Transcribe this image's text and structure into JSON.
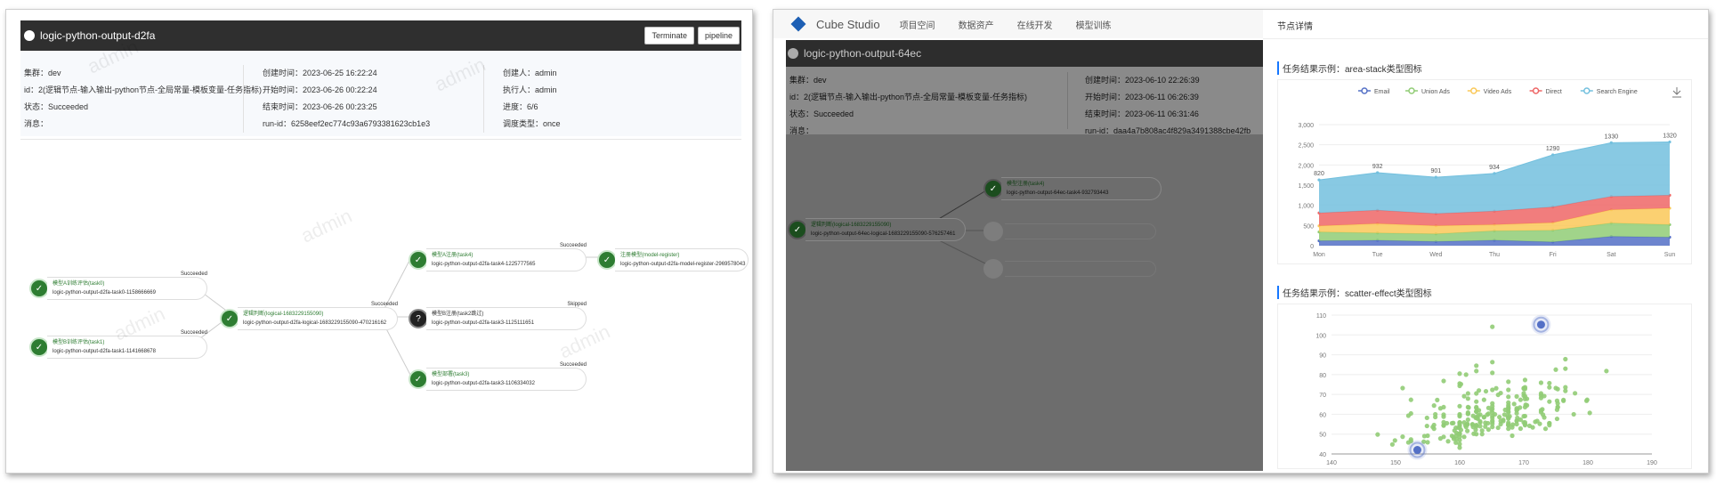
{
  "left": {
    "title": "logic-python-output-d2fa",
    "buttons": [
      "Terminate",
      "pipeline"
    ],
    "info_col1": [
      "集群：dev",
      "id：2(逻辑节点-输入输出-python节点-全局常量-模板变量-任务指标)",
      "状态：Succeeded",
      "消息："
    ],
    "info_col2": [
      "创建时间：2023-06-25 16:22:24",
      "开始时间：2023-06-26 00:22:24",
      "结束时间：2023-06-26 00:23:25",
      "run-id：6258eef2ec774c93a6793381623cb1e3"
    ],
    "info_col3": [
      "创建人：admin",
      "执行人：admin",
      "进度：6/6",
      "调度类型：once"
    ],
    "nodes": [
      {
        "name": "模型A训练评估(task0)",
        "id": "logic-python-output-d2fa-task0-1158666669",
        "status": "Succeeded",
        "dark": false
      },
      {
        "name": "模型B训练评估(task1)",
        "id": "logic-python-output-d2fa-task1-1141668678",
        "status": "Succeeded",
        "dark": false
      },
      {
        "name": "逻辑判断(logical-1683229155090)",
        "id": "logic-python-output-d2fa-logical-1683229155090-470216162",
        "status": "Succeeded",
        "dark": false
      },
      {
        "name": "模型A注册(task4)",
        "id": "logic-python-output-d2fa-task4-1225777565",
        "status": "Succeeded",
        "dark": false
      },
      {
        "name": "模型B注册(task2跳过)",
        "id": "logic-python-output-d2fa-task3-1125111651",
        "status": "Skipped",
        "dark": true
      },
      {
        "name": "模型部署(task3)",
        "id": "logic-python-output-d2fa-task3-1106334032",
        "status": "Succeeded",
        "dark": false
      },
      {
        "name": "注册模型(model-register)",
        "id": "logic-python-output-d2fa-model-register-2969578043",
        "status": "",
        "dark": false
      }
    ],
    "watermark": "admin"
  },
  "right": {
    "brand": "Cube Studio",
    "nav": [
      "项目空间",
      "数据资产",
      "在线开发",
      "模型训练"
    ],
    "title": "logic-python-output-64ec",
    "info_col1": [
      "集群：dev",
      "id：2(逻辑节点-输入输出-python节点-全局常量-模板变量-任务指标)",
      "状态：Succeeded",
      "消息："
    ],
    "info_col2": [
      "创建时间：2023-06-10 22:26:39",
      "开始时间：2023-06-11 06:26:39",
      "结束时间：2023-06-11 06:31:46",
      "run-id：daa4a7b808ac4f829a3491388cbe42fb"
    ],
    "nodes": [
      {
        "name": "模型注册(task4)",
        "id": "logic-python-output-64ec-task4-932793443"
      },
      {
        "name": "逻辑判断(logical-1683229155090)",
        "id": "logic-python-output-64ec-logical-1683229155090-576257461"
      }
    ],
    "drawer_title": "节点详情",
    "section1": "任务结果示例：area-stack类型图标",
    "section2": "任务结果示例：scatter-effect类型图标"
  },
  "chart_data": [
    {
      "type": "area",
      "stacked": true,
      "title": "",
      "categories": [
        "Mon",
        "Tue",
        "Wed",
        "Thu",
        "Fri",
        "Sat",
        "Sun"
      ],
      "series": [
        {
          "name": "Email",
          "values": [
            120,
            132,
            101,
            134,
            90,
            230,
            210
          ],
          "color": "#5470c6"
        },
        {
          "name": "Union Ads",
          "values": [
            220,
            182,
            191,
            234,
            290,
            330,
            310
          ],
          "color": "#91cc75"
        },
        {
          "name": "Video Ads",
          "values": [
            150,
            232,
            201,
            154,
            190,
            330,
            410
          ],
          "color": "#fac858"
        },
        {
          "name": "Direct",
          "values": [
            320,
            332,
            301,
            334,
            390,
            330,
            320
          ],
          "color": "#ee6666"
        },
        {
          "name": "Search Engine",
          "values": [
            820,
            932,
            901,
            934,
            1290,
            1330,
            1320
          ],
          "color": "#73c0de"
        }
      ],
      "top_labels": [
        "820",
        "932",
        "901",
        "934",
        "1290",
        "1330",
        "1320"
      ],
      "yticks": [
        "0",
        "500",
        "1,000",
        "1,500",
        "2,000",
        "2,500",
        "3,000"
      ],
      "ylim": [
        0,
        3000
      ],
      "legend": "top-center",
      "grid": true
    },
    {
      "type": "scatter",
      "title": "",
      "xticks": [
        "140",
        "150",
        "160",
        "170",
        "180",
        "190"
      ],
      "yticks": [
        "40",
        "50",
        "60",
        "70",
        "80",
        "90",
        "100",
        "110"
      ],
      "xlim": [
        140,
        190
      ],
      "ylim": [
        40,
        110
      ],
      "effect_points": [
        [
          153.4,
          42.0
        ],
        [
          172.7,
          105.2
        ]
      ],
      "points": [
        [
          161.2,
          51.6
        ],
        [
          167.5,
          59.0
        ],
        [
          159.5,
          49.2
        ],
        [
          157.0,
          63.0
        ],
        [
          155.8,
          53.6
        ],
        [
          170.0,
          59.0
        ],
        [
          159.1,
          47.6
        ],
        [
          166.0,
          69.8
        ],
        [
          176.2,
          66.8
        ],
        [
          160.2,
          75.2
        ],
        [
          172.5,
          55.2
        ],
        [
          170.9,
          54.2
        ],
        [
          172.9,
          62.5
        ],
        [
          153.4,
          42.0
        ],
        [
          160.0,
          50.0
        ],
        [
          147.2,
          49.8
        ],
        [
          168.2,
          49.2
        ],
        [
          175.0,
          73.2
        ],
        [
          157.0,
          47.8
        ],
        [
          167.6,
          68.8
        ],
        [
          159.5,
          50.6
        ],
        [
          175.0,
          82.5
        ],
        [
          166.8,
          57.2
        ],
        [
          176.5,
          87.8
        ],
        [
          170.2,
          72.8
        ],
        [
          174.0,
          54.5
        ],
        [
          173.0,
          59.8
        ],
        [
          179.9,
          67.3
        ],
        [
          170.5,
          67.8
        ],
        [
          160.0,
          47.0
        ],
        [
          154.4,
          46.2
        ],
        [
          162.0,
          55.0
        ],
        [
          176.5,
          83.0
        ],
        [
          160.0,
          54.4
        ],
        [
          152.0,
          45.8
        ],
        [
          162.1,
          53.6
        ],
        [
          170.0,
          73.2
        ],
        [
          160.2,
          52.1
        ],
        [
          161.3,
          67.9
        ],
        [
          166.4,
          56.6
        ],
        [
          168.9,
          62.3
        ],
        [
          163.8,
          58.5
        ],
        [
          167.6,
          54.5
        ],
        [
          160.0,
          50.2
        ],
        [
          161.3,
          60.3
        ],
        [
          167.6,
          58.3
        ],
        [
          165.1,
          56.2
        ],
        [
          160.0,
          50.2
        ],
        [
          170.0,
          72.9
        ],
        [
          157.5,
          59.8
        ],
        [
          167.6,
          61.0
        ],
        [
          160.7,
          69.1
        ],
        [
          163.2,
          55.9
        ],
        [
          152.4,
          46.5
        ],
        [
          157.5,
          54.3
        ],
        [
          168.3,
          54.8
        ],
        [
          180.3,
          60.7
        ],
        [
          165.5,
          60.0
        ],
        [
          165.0,
          62.0
        ],
        [
          164.5,
          60.3
        ],
        [
          156.0,
          52.7
        ],
        [
          160.0,
          74.3
        ],
        [
          163.0,
          62.0
        ],
        [
          165.7,
          73.1
        ],
        [
          161.0,
          80.0
        ],
        [
          162.0,
          54.7
        ],
        [
          166.0,
          53.2
        ],
        [
          174.0,
          75.7
        ],
        [
          172.7,
          61.1
        ],
        [
          167.6,
          55.7
        ],
        [
          151.1,
          48.7
        ],
        [
          164.5,
          52.3
        ],
        [
          163.5,
          50.0
        ],
        [
          152.0,
          59.3
        ],
        [
          169.0,
          62.5
        ],
        [
          164.0,
          55.7
        ],
        [
          161.2,
          54.8
        ],
        [
          155.0,
          45.9
        ],
        [
          170.0,
          70.6
        ],
        [
          176.2,
          67.2
        ],
        [
          170.0,
          69.4
        ],
        [
          162.5,
          58.2
        ],
        [
          170.3,
          64.8
        ],
        [
          164.1,
          71.6
        ],
        [
          169.5,
          52.8
        ],
        [
          163.2,
          59.8
        ],
        [
          154.5,
          49.0
        ],
        [
          159.8,
          50.0
        ],
        [
          173.2,
          69.2
        ],
        [
          170.0,
          55.9
        ],
        [
          161.4,
          63.4
        ],
        [
          169.0,
          58.2
        ],
        [
          166.2,
          58.6
        ],
        [
          159.4,
          45.7
        ],
        [
          162.5,
          52.2
        ],
        [
          159.0,
          48.6
        ],
        [
          162.8,
          57.8
        ],
        [
          159.0,
          55.6
        ],
        [
          179.8,
          66.8
        ],
        [
          162.9,
          59.4
        ],
        [
          161.0,
          53.6
        ],
        [
          151.1,
          73.2
        ],
        [
          168.2,
          53.4
        ],
        [
          168.9,
          69.0
        ],
        [
          173.2,
          58.4
        ],
        [
          171.8,
          56.2
        ],
        [
          178.0,
          70.6
        ],
        [
          164.3,
          59.8
        ],
        [
          163.0,
          72.0
        ],
        [
          168.5,
          65.2
        ],
        [
          166.8,
          56.6
        ],
        [
          172.7,
          105.2
        ],
        [
          163.5,
          51.8
        ],
        [
          169.4,
          63.4
        ],
        [
          167.8,
          59.0
        ],
        [
          159.5,
          47.6
        ],
        [
          167.6,
          63.0
        ],
        [
          161.2,
          55.2
        ],
        [
          160.0,
          45.0
        ],
        [
          163.2,
          54.0
        ],
        [
          162.2,
          50.2
        ],
        [
          161.3,
          60.2
        ],
        [
          149.5,
          44.8
        ],
        [
          157.5,
          58.8
        ],
        [
          163.2,
          56.4
        ],
        [
          172.7,
          62.0
        ],
        [
          155.0,
          49.2
        ],
        [
          156.5,
          67.2
        ],
        [
          164.0,
          53.8
        ],
        [
          160.9,
          54.4
        ],
        [
          162.8,
          58.0
        ],
        [
          167.0,
          59.8
        ],
        [
          160.0,
          54.8
        ],
        [
          160.0,
          43.2
        ],
        [
          168.9,
          60.5
        ],
        [
          158.2,
          46.4
        ],
        [
          156.0,
          64.4
        ],
        [
          160.0,
          48.8
        ],
        [
          167.1,
          62.2
        ],
        [
          158.0,
          55.5
        ],
        [
          167.6,
          57.8
        ],
        [
          156.0,
          54.6
        ],
        [
          162.1,
          59.2
        ],
        [
          173.4,
          52.7
        ],
        [
          159.8,
          53.2
        ],
        [
          170.5,
          64.5
        ],
        [
          159.2,
          51.8
        ],
        [
          157.5,
          56.0
        ],
        [
          161.3,
          63.6
        ],
        [
          162.6,
          63.2
        ],
        [
          160.0,
          59.5
        ],
        [
          168.9,
          56.8
        ],
        [
          165.1,
          64.1
        ],
        [
          162.6,
          50.0
        ],
        [
          165.1,
          72.3
        ],
        [
          166.4,
          55.0
        ],
        [
          160.0,
          55.9
        ],
        [
          152.4,
          60.4
        ],
        [
          170.2,
          69.1
        ],
        [
          162.6,
          84.5
        ],
        [
          170.2,
          55.9
        ],
        [
          158.8,
          55.5
        ],
        [
          172.7,
          69.5
        ],
        [
          167.6,
          76.4
        ],
        [
          162.6,
          61.4
        ],
        [
          167.6,
          65.9
        ],
        [
          156.2,
          58.6
        ],
        [
          175.2,
          66.8
        ],
        [
          172.1,
          56.6
        ],
        [
          162.6,
          58.6
        ],
        [
          160.0,
          55.9
        ],
        [
          165.1,
          59.1
        ],
        [
          182.9,
          81.8
        ],
        [
          166.4,
          70.7
        ],
        [
          165.1,
          56.8
        ],
        [
          177.8,
          60.0
        ],
        [
          165.1,
          58.2
        ],
        [
          175.3,
          72.7
        ],
        [
          154.9,
          54.1
        ],
        [
          158.8,
          49.1
        ],
        [
          172.7,
          75.9
        ],
        [
          168.9,
          55.0
        ],
        [
          161.3,
          57.3
        ],
        [
          167.6,
          55.0
        ],
        [
          165.1,
          65.5
        ],
        [
          175.3,
          65.5
        ],
        [
          157.5,
          48.6
        ],
        [
          163.8,
          58.6
        ],
        [
          167.6,
          63.6
        ],
        [
          165.1,
          55.2
        ],
        [
          165.1,
          62.7
        ],
        [
          168.9,
          56.6
        ],
        [
          162.6,
          53.9
        ],
        [
          164.5,
          63.2
        ],
        [
          176.5,
          73.6
        ],
        [
          168.9,
          62.0
        ],
        [
          175.3,
          63.6
        ],
        [
          159.4,
          53.2
        ],
        [
          160.0,
          53.4
        ],
        [
          170.2,
          55.0
        ],
        [
          162.6,
          70.5
        ],
        [
          167.6,
          54.5
        ],
        [
          162.6,
          54.5
        ],
        [
          160.7,
          55.9
        ],
        [
          160.0,
          59.0
        ],
        [
          157.5,
          63.6
        ],
        [
          162.6,
          54.5
        ],
        [
          152.4,
          47.3
        ],
        [
          170.2,
          67.7
        ],
        [
          165.1,
          80.9
        ],
        [
          172.7,
          70.5
        ],
        [
          165.1,
          60.9
        ],
        [
          170.2,
          63.6
        ],
        [
          170.2,
          54.5
        ],
        [
          170.2,
          59.1
        ],
        [
          161.3,
          70.5
        ],
        [
          167.6,
          52.7
        ],
        [
          167.6,
          62.7
        ],
        [
          165.1,
          86.3
        ],
        [
          162.6,
          66.4
        ],
        [
          152.4,
          67.3
        ],
        [
          168.9,
          63.0
        ],
        [
          170.2,
          73.6
        ],
        [
          175.2,
          62.3
        ],
        [
          175.2,
          57.7
        ],
        [
          160.0,
          55.4
        ],
        [
          165.1,
          104.1
        ],
        [
          174.0,
          55.5
        ],
        [
          170.2,
          77.3
        ],
        [
          160.0,
          80.5
        ],
        [
          167.6,
          64.5
        ],
        [
          167.6,
          72.3
        ],
        [
          167.6,
          61.4
        ],
        [
          154.9,
          58.2
        ],
        [
          162.6,
          81.8
        ],
        [
          175.3,
          63.6
        ],
        [
          171.4,
          53.4
        ],
        [
          157.5,
          54.5
        ],
        [
          165.1,
          53.6
        ],
        [
          160.0,
          60.0
        ],
        [
          174.0,
          73.6
        ],
        [
          162.6,
          61.4
        ],
        [
          174.0,
          55.5
        ],
        [
          162.6,
          63.6
        ],
        [
          161.3,
          60.9
        ],
        [
          156.2,
          60.0
        ],
        [
          149.9,
          46.8
        ],
        [
          169.5,
          57.3
        ],
        [
          160.0,
          64.1
        ],
        [
          175.3,
          63.6
        ],
        [
          169.5,
          67.3
        ],
        [
          160.0,
          75.5
        ],
        [
          172.7,
          68.2
        ],
        [
          162.6,
          61.4
        ],
        [
          157.5,
          76.8
        ],
        [
          176.5,
          71.8
        ],
        [
          164.4,
          55.5
        ],
        [
          160.7,
          48.6
        ],
        [
          174.0,
          66.4
        ],
        [
          163.8,
          67.3
        ]
      ]
    }
  ]
}
